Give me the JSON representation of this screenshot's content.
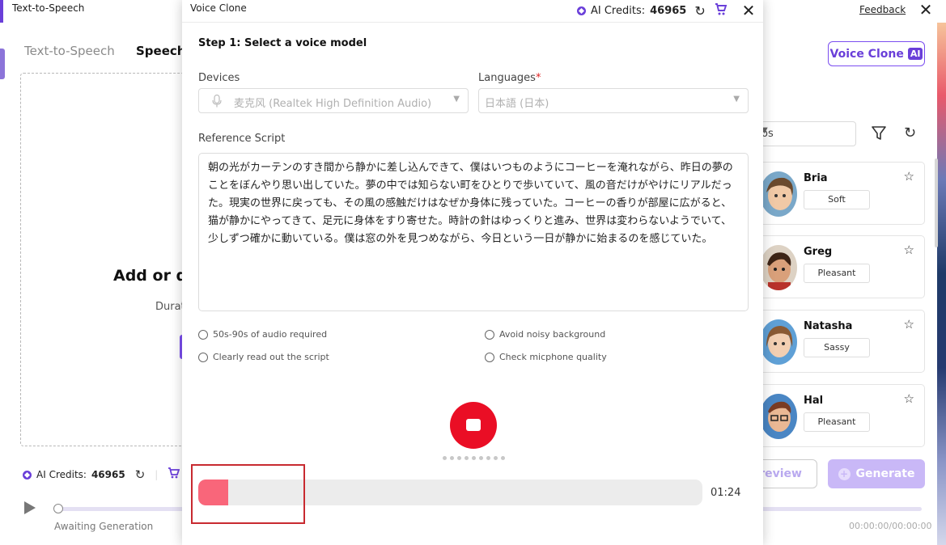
{
  "background": {
    "window_title": "Text-to-Speech",
    "feedback_label": "Feedback",
    "tabs": [
      {
        "label": "Text-to-Speech",
        "active": false
      },
      {
        "label": "Speech",
        "active": true
      }
    ],
    "drop_title": "Add or d",
    "drop_subtitle": "Durat",
    "credits_label": "AI Credits:",
    "credits_value": "46965",
    "voice_clone_label": "Voice Clone",
    "voice_clone_badge": "AI",
    "filter_select_value": "os",
    "voices": [
      {
        "name": "Bria",
        "tag": "Soft"
      },
      {
        "name": "Greg",
        "tag": "Pleasant"
      },
      {
        "name": "Natasha",
        "tag": "Sassy"
      },
      {
        "name": "Hal",
        "tag": "Pleasant"
      }
    ],
    "preview_label": "review",
    "generate_label": "Generate",
    "player_status": "Awaiting Generation",
    "player_time": "00:00:00/00:00:00"
  },
  "modal": {
    "title": "Voice Clone",
    "credits_label": "AI Credits:",
    "credits_value": "46965",
    "step_title": "Step 1: Select a voice model",
    "devices_label": "Devices",
    "device_value": "麦克风 (Realtek High Definition Audio)",
    "languages_label": "Languages",
    "required_mark": "*",
    "language_value": "日本語 (日本)",
    "reference_label": "Reference Script",
    "reference_script": "朝の光がカーテンのすき間から静かに差し込んできて、僕はいつものようにコーヒーを淹れながら、昨日の夢のことをぼんやり思い出していた。夢の中では知らない町をひとりで歩いていて、風の音だけがやけにリアルだった。現実の世界に戻っても、その風の感触だけはなぜか身体に残っていた。コーヒーの香りが部屋に広がると、猫が静かにやってきて、足元に身体をすり寄せた。時計の針はゆっくりと進み、世界は変わらないようでいて、少しずつ確かに動いている。僕は窓の外を見つめながら、今日という一日が静かに始まるのを感じていた。",
    "tips": [
      "50s-90s of audio required",
      "Avoid noisy background",
      "Clearly read out the script",
      "Check micphone quality"
    ],
    "recording_elapsed": "01:24",
    "recording_progress_percent": 6
  },
  "colors": {
    "accent": "#6a3fd9",
    "record_red": "#ea0e25",
    "progress_fill": "#f9667a",
    "highlight_box": "#c82a30"
  }
}
